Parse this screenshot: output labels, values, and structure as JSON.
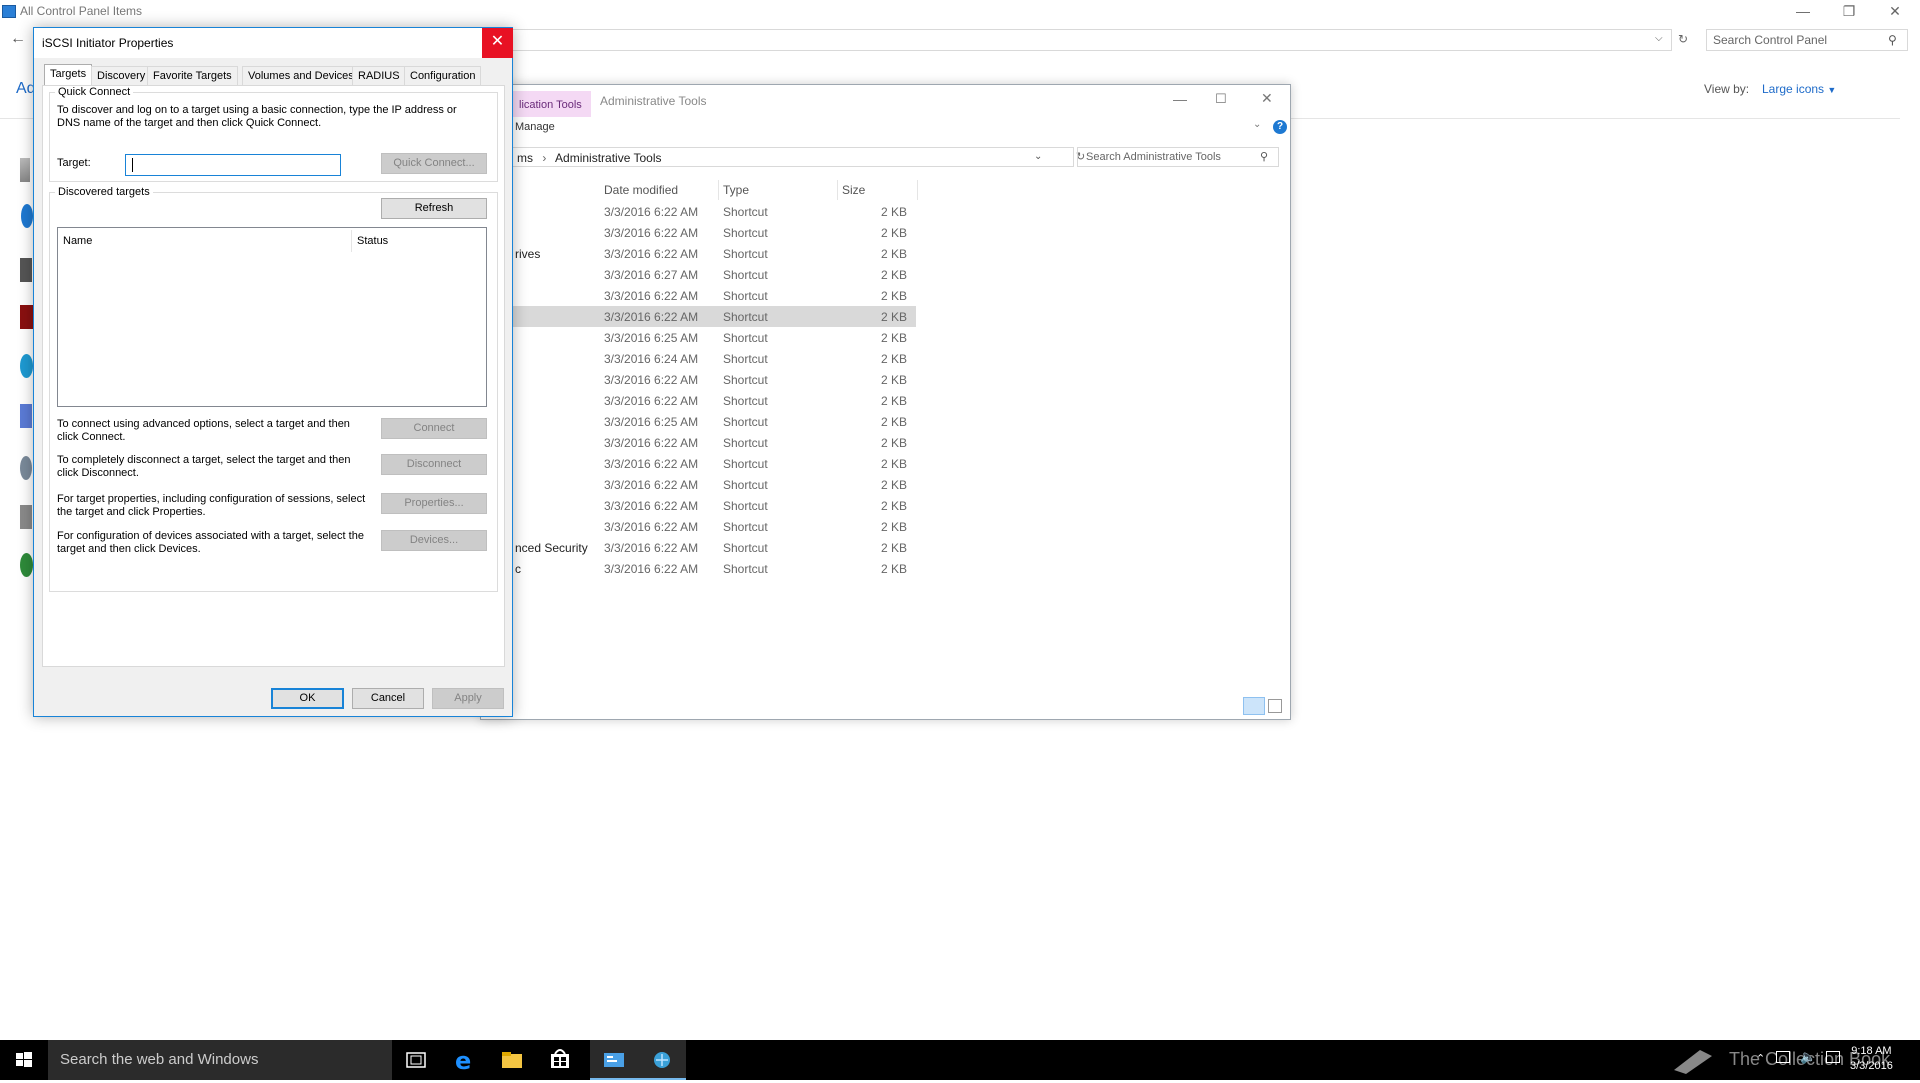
{
  "cp": {
    "title": "All Control Panel Items",
    "search_placeholder": "Search Control Panel",
    "view_by_label": "View by:",
    "view_by_value": "Large icons",
    "side_title": "Ad"
  },
  "at": {
    "ribbon_tab": "lication Tools",
    "title": "Administrative Tools",
    "manage": "Manage",
    "breadcrumb_prefix": "ms",
    "breadcrumb": "Administrative Tools",
    "search_placeholder": "Search Administrative Tools",
    "columns": [
      "Date modified",
      "Type",
      "Size"
    ],
    "rows": [
      {
        "name": "",
        "date": "3/3/2016 6:22 AM",
        "type": "Shortcut",
        "size": "2 KB"
      },
      {
        "name": "",
        "date": "3/3/2016 6:22 AM",
        "type": "Shortcut",
        "size": "2 KB"
      },
      {
        "name": "rives",
        "date": "3/3/2016 6:22 AM",
        "type": "Shortcut",
        "size": "2 KB"
      },
      {
        "name": "",
        "date": "3/3/2016 6:27 AM",
        "type": "Shortcut",
        "size": "2 KB"
      },
      {
        "name": "",
        "date": "3/3/2016 6:22 AM",
        "type": "Shortcut",
        "size": "2 KB"
      },
      {
        "name": "",
        "date": "3/3/2016 6:22 AM",
        "type": "Shortcut",
        "size": "2 KB"
      },
      {
        "name": "",
        "date": "3/3/2016 6:25 AM",
        "type": "Shortcut",
        "size": "2 KB"
      },
      {
        "name": "",
        "date": "3/3/2016 6:24 AM",
        "type": "Shortcut",
        "size": "2 KB"
      },
      {
        "name": "",
        "date": "3/3/2016 6:22 AM",
        "type": "Shortcut",
        "size": "2 KB"
      },
      {
        "name": "",
        "date": "3/3/2016 6:22 AM",
        "type": "Shortcut",
        "size": "2 KB"
      },
      {
        "name": "",
        "date": "3/3/2016 6:25 AM",
        "type": "Shortcut",
        "size": "2 KB"
      },
      {
        "name": "",
        "date": "3/3/2016 6:22 AM",
        "type": "Shortcut",
        "size": "2 KB"
      },
      {
        "name": "",
        "date": "3/3/2016 6:22 AM",
        "type": "Shortcut",
        "size": "2 KB"
      },
      {
        "name": "",
        "date": "3/3/2016 6:22 AM",
        "type": "Shortcut",
        "size": "2 KB"
      },
      {
        "name": "",
        "date": "3/3/2016 6:22 AM",
        "type": "Shortcut",
        "size": "2 KB"
      },
      {
        "name": "",
        "date": "3/3/2016 6:22 AM",
        "type": "Shortcut",
        "size": "2 KB"
      },
      {
        "name": "nced Security",
        "date": "3/3/2016 6:22 AM",
        "type": "Shortcut",
        "size": "2 KB"
      },
      {
        "name": "c",
        "date": "3/3/2016 6:22 AM",
        "type": "Shortcut",
        "size": "2 KB"
      }
    ],
    "selected_row": 5
  },
  "dlg": {
    "title": "iSCSI Initiator Properties",
    "tabs": [
      "Targets",
      "Discovery",
      "Favorite Targets",
      "Volumes and Devices",
      "RADIUS",
      "Configuration"
    ],
    "quick_connect_group": "Quick Connect",
    "quick_connect_help": "To discover and log on to a target using a basic connection, type the IP address or DNS name of the target and then click Quick Connect.",
    "target_label": "Target:",
    "target_value": "",
    "quick_connect_btn": "Quick Connect...",
    "discovered_group": "Discovered targets",
    "refresh_btn": "Refresh",
    "list_cols": [
      "Name",
      "Status"
    ],
    "connect_help": "To connect using advanced options, select a target and then click Connect.",
    "connect_btn": "Connect",
    "disconnect_help": "To completely disconnect a target, select the target and then click Disconnect.",
    "disconnect_btn": "Disconnect",
    "properties_help": "For target properties, including configuration of sessions, select the target and click Properties.",
    "properties_btn": "Properties...",
    "devices_help": "For configuration of devices associated with a target, select the target and then click Devices.",
    "devices_btn": "Devices...",
    "ok_btn": "OK",
    "cancel_btn": "Cancel",
    "apply_btn": "Apply"
  },
  "taskbar": {
    "search_placeholder": "Search the web and Windows",
    "time": "9:18 AM",
    "date": "3/3/2016",
    "watermark": "The Collection Book"
  }
}
